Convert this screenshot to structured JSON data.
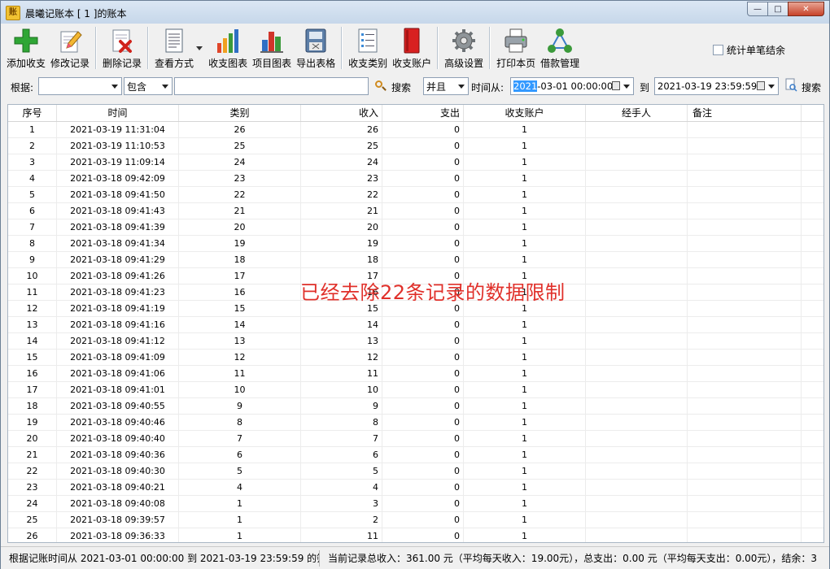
{
  "window": {
    "app_icon_text": "账",
    "title": "晨曦记账本  [ 1 ]的账本",
    "minimize_glyph": "—",
    "maximize_glyph": "□",
    "close_glyph": "✕"
  },
  "toolbar": {
    "buttons": [
      {
        "label": "添加收支",
        "icon": "add-plus-icon"
      },
      {
        "label": "修改记录",
        "icon": "edit-pencil-icon"
      },
      {
        "label": "删除记录",
        "icon": "delete-doc-icon"
      },
      {
        "label": "查看方式",
        "icon": "view-document-icon"
      },
      {
        "label": "收支图表",
        "icon": "bar-chart-icon"
      },
      {
        "label": "项目图表",
        "icon": "project-chart-icon"
      },
      {
        "label": "导出表格",
        "icon": "export-table-icon"
      },
      {
        "label": "收支类别",
        "icon": "category-list-icon"
      },
      {
        "label": "收支账户",
        "icon": "account-book-icon"
      },
      {
        "label": "高级设置",
        "icon": "gear-icon"
      },
      {
        "label": "打印本页",
        "icon": "printer-icon"
      },
      {
        "label": "借款管理",
        "icon": "network-icon"
      }
    ],
    "checkbox_label": "统计单笔结余",
    "checkbox_checked": false
  },
  "filter": {
    "basis_label": "根据:",
    "field_select_value": "",
    "match_select_value": "包含",
    "keyword_value": "",
    "search_label": "搜索",
    "logic_select_value": "并且",
    "time_from_label": "时间从:",
    "time_from_selected": "2021",
    "time_from_rest": "-03-01 00:00:00",
    "to_label": "到",
    "time_to_value": "2021-03-19 23:59:59",
    "search2_label": "搜索"
  },
  "table": {
    "columns": [
      "序号",
      "时间",
      "类别",
      "收入",
      "支出",
      "收支账户",
      "经手人",
      "备注"
    ],
    "rows": [
      [
        "1",
        "2021-03-19 11:31:04",
        "26",
        "26",
        "0",
        "1",
        "",
        ""
      ],
      [
        "2",
        "2021-03-19 11:10:53",
        "25",
        "25",
        "0",
        "1",
        "",
        ""
      ],
      [
        "3",
        "2021-03-19 11:09:14",
        "24",
        "24",
        "0",
        "1",
        "",
        ""
      ],
      [
        "4",
        "2021-03-18 09:42:09",
        "23",
        "23",
        "0",
        "1",
        "",
        ""
      ],
      [
        "5",
        "2021-03-18 09:41:50",
        "22",
        "22",
        "0",
        "1",
        "",
        ""
      ],
      [
        "6",
        "2021-03-18 09:41:43",
        "21",
        "21",
        "0",
        "1",
        "",
        ""
      ],
      [
        "7",
        "2021-03-18 09:41:39",
        "20",
        "20",
        "0",
        "1",
        "",
        ""
      ],
      [
        "8",
        "2021-03-18 09:41:34",
        "19",
        "19",
        "0",
        "1",
        "",
        ""
      ],
      [
        "9",
        "2021-03-18 09:41:29",
        "18",
        "18",
        "0",
        "1",
        "",
        ""
      ],
      [
        "10",
        "2021-03-18 09:41:26",
        "17",
        "17",
        "0",
        "1",
        "",
        ""
      ],
      [
        "11",
        "2021-03-18 09:41:23",
        "16",
        "16",
        "0",
        "1",
        "",
        ""
      ],
      [
        "12",
        "2021-03-18 09:41:19",
        "15",
        "15",
        "0",
        "1",
        "",
        ""
      ],
      [
        "13",
        "2021-03-18 09:41:16",
        "14",
        "14",
        "0",
        "1",
        "",
        ""
      ],
      [
        "14",
        "2021-03-18 09:41:12",
        "13",
        "13",
        "0",
        "1",
        "",
        ""
      ],
      [
        "15",
        "2021-03-18 09:41:09",
        "12",
        "12",
        "0",
        "1",
        "",
        ""
      ],
      [
        "16",
        "2021-03-18 09:41:06",
        "11",
        "11",
        "0",
        "1",
        "",
        ""
      ],
      [
        "17",
        "2021-03-18 09:41:01",
        "10",
        "10",
        "0",
        "1",
        "",
        ""
      ],
      [
        "18",
        "2021-03-18 09:40:55",
        "9",
        "9",
        "0",
        "1",
        "",
        ""
      ],
      [
        "19",
        "2021-03-18 09:40:46",
        "8",
        "8",
        "0",
        "1",
        "",
        ""
      ],
      [
        "20",
        "2021-03-18 09:40:40",
        "7",
        "7",
        "0",
        "1",
        "",
        ""
      ],
      [
        "21",
        "2021-03-18 09:40:36",
        "6",
        "6",
        "0",
        "1",
        "",
        ""
      ],
      [
        "22",
        "2021-03-18 09:40:30",
        "5",
        "5",
        "0",
        "1",
        "",
        ""
      ],
      [
        "23",
        "2021-03-18 09:40:21",
        "4",
        "4",
        "0",
        "1",
        "",
        ""
      ],
      [
        "24",
        "2021-03-18 09:40:08",
        "1",
        "3",
        "0",
        "1",
        "",
        ""
      ],
      [
        "25",
        "2021-03-18 09:39:57",
        "1",
        "2",
        "0",
        "1",
        "",
        ""
      ],
      [
        "26",
        "2021-03-18 09:36:33",
        "1",
        "11",
        "0",
        "1",
        "",
        ""
      ]
    ]
  },
  "overlay": {
    "message": "已经去除22条记录的数据限制",
    "color": "#e0302a"
  },
  "status": {
    "left": "根据记账时间从 2021-03-01 00:00:00 到 2021-03-19 23:59:59 的筛选",
    "right": "当前记录总收入：361.00 元（平均每天收入：19.00元），总支出：0.00 元（平均每天支出：0.00元），结余：3"
  }
}
